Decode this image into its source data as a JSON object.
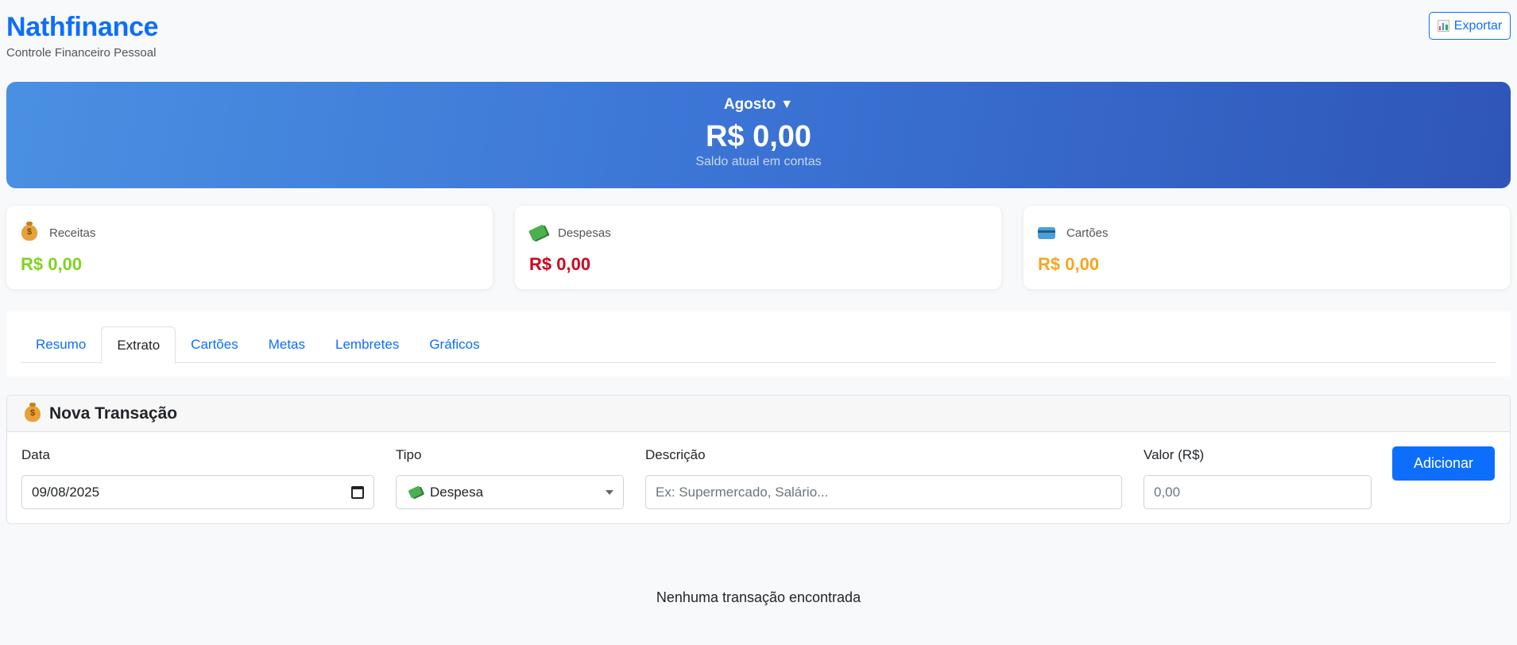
{
  "app": {
    "title": "Nathfinance",
    "subtitle": "Controle Financeiro Pessoal",
    "brand_color": "#0d6efd"
  },
  "toolbar": {
    "export_label": "Exportar",
    "export_icon": "bar-chart-icon"
  },
  "balance": {
    "month": "Agosto",
    "month_icon": "triangle-down-icon",
    "value": "R$ 0,00",
    "label": "Saldo atual em contas"
  },
  "stats": [
    {
      "label": "Receitas",
      "value": "R$ 0,00",
      "icon": "money-bag-icon",
      "color": "#7ed321"
    },
    {
      "label": "Despesas",
      "value": "R$ 0,00",
      "icon": "money-wings-icon",
      "color": "#d0021b"
    },
    {
      "label": "Cartões",
      "value": "R$ 0,00",
      "icon": "credit-card-icon",
      "color": "#f5a623"
    }
  ],
  "tabs": [
    {
      "label": "Resumo",
      "active": false
    },
    {
      "label": "Extrato",
      "active": true
    },
    {
      "label": "Cartões",
      "active": false
    },
    {
      "label": "Metas",
      "active": false
    },
    {
      "label": "Lembretes",
      "active": false
    },
    {
      "label": "Gráficos",
      "active": false
    }
  ],
  "transaction_form": {
    "title": "Nova Transação",
    "title_icon": "money-bag-icon",
    "date": {
      "label": "Data",
      "value": "09/08/2025"
    },
    "type": {
      "label": "Tipo",
      "value": "Despesa",
      "icon": "money-wings-icon"
    },
    "description": {
      "label": "Descrição",
      "placeholder": "Ex: Supermercado, Salário..."
    },
    "amount": {
      "label": "Valor (R$)",
      "placeholder": "0,00"
    },
    "submit_label": "Adicionar"
  },
  "empty_state": "Nenhuma transação encontrada"
}
